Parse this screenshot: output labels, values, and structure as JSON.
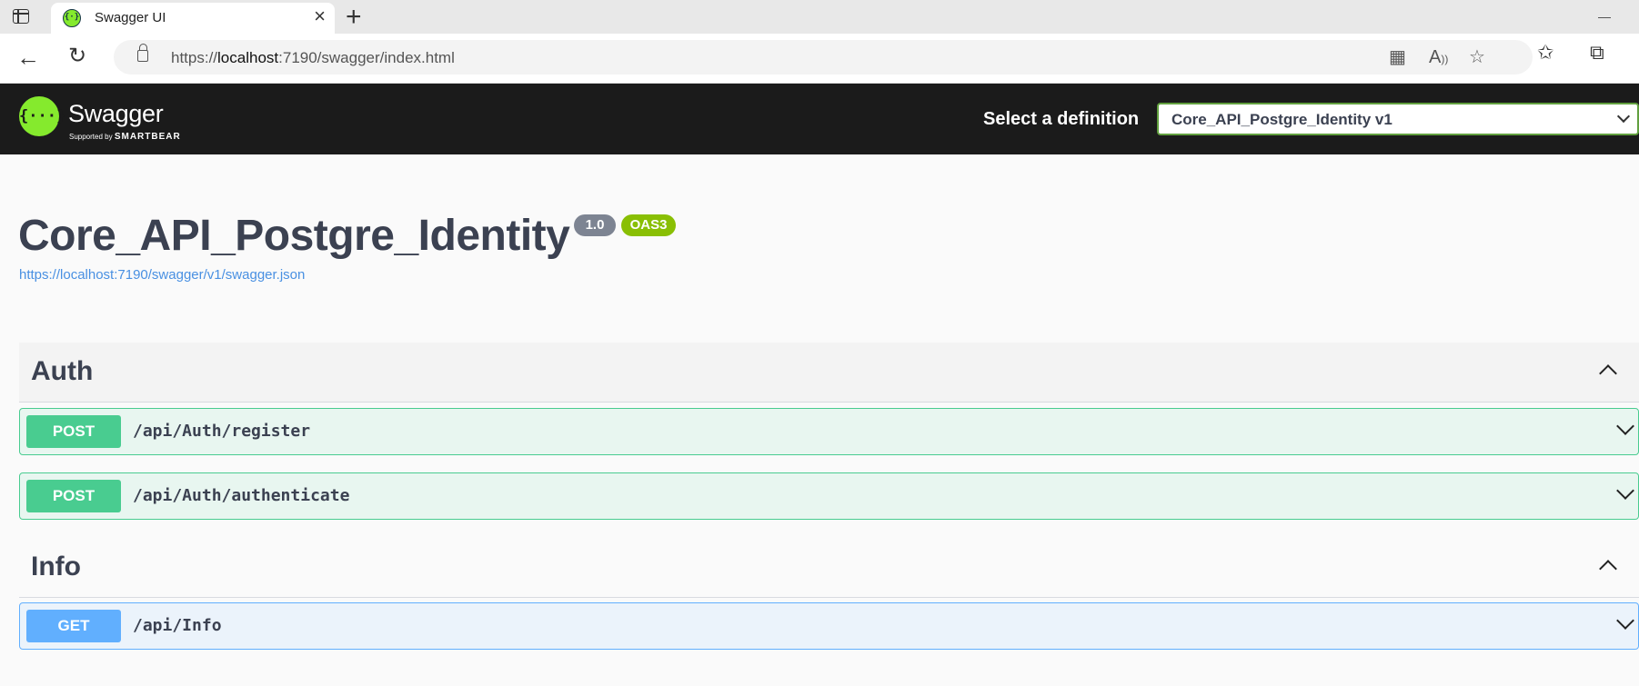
{
  "browser": {
    "tab_title": "Swagger UI",
    "url_prefix": "https://",
    "url_host": "localhost",
    "url_rest": ":7190/swagger/index.html"
  },
  "topbar": {
    "logo_word": "Swagger",
    "logo_supported": "Supported by",
    "logo_brand": "SMARTBEAR",
    "select_label": "Select a definition",
    "selected_definition": "Core_API_Postgre_Identity v1"
  },
  "info": {
    "title": "Core_API_Postgre_Identity",
    "version": "1.0",
    "oas": "OAS3",
    "spec_url": "https://localhost:7190/swagger/v1/swagger.json"
  },
  "tags": [
    {
      "name": "Auth",
      "operations": [
        {
          "method": "POST",
          "path": "/api/Auth/register"
        },
        {
          "method": "POST",
          "path": "/api/Auth/authenticate"
        }
      ]
    },
    {
      "name": "Info",
      "operations": [
        {
          "method": "GET",
          "path": "/api/Info"
        }
      ]
    }
  ],
  "colors": {
    "post": "#49cc90",
    "get": "#61affe",
    "swagger_green": "#85ea2d",
    "topbar": "#1b1b1b"
  }
}
